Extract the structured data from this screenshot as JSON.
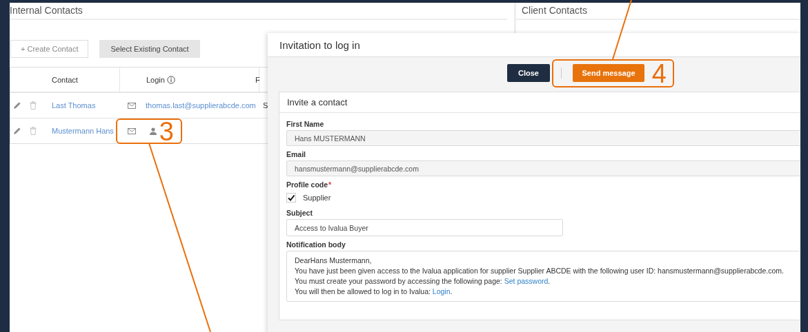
{
  "internal_contacts": {
    "title": "Internal Contacts",
    "buttons": [
      {
        "label": "+ Create Contact",
        "kind": "outline"
      },
      {
        "label": "Select Existing Contact",
        "kind": "filled"
      }
    ],
    "columns": [
      {
        "label": "Contact"
      },
      {
        "label": "Login",
        "info": true
      },
      {
        "label": "F"
      }
    ],
    "rows": [
      {
        "contact": "Last Thomas",
        "login": "thomas.last@supplierabcde.com",
        "column_3": "S",
        "kind": "login"
      },
      {
        "contact": "Mustermann Hans",
        "kind": "no_login"
      }
    ]
  },
  "client_contacts": {
    "title": "Client Contacts"
  },
  "modal": {
    "title": "Invitation to log in",
    "buttons": [
      {
        "label": "Close",
        "kind": "secondary"
      },
      {
        "label": "Send message",
        "kind": "primary"
      }
    ],
    "section": {
      "title": "Invite a contact",
      "fields": [
        {
          "kind": "text",
          "label": "First Name",
          "value": "Hans MUSTERMANN",
          "disabled": true
        },
        {
          "kind": "text",
          "label": "Email",
          "value": "hansmustermann@supplierabcde.com",
          "disabled": true
        },
        {
          "kind": "checkbox",
          "label": "Profile code",
          "required_mark": "*",
          "option": "Supplier",
          "checked": true
        },
        {
          "kind": "short_text",
          "label": "Subject",
          "value": "Access to Ivalua Buyer",
          "disabled": false
        },
        {
          "kind": "body",
          "label": "Notification body",
          "lines": [
            [
              {
                "text": "DearHans Mustermann,"
              }
            ],
            [
              {
                "text": "You have just been given access to the Ivalua application for supplier Supplier ABCDE with the following user ID: hansmustermann@supplierabcde.com."
              }
            ],
            [
              {
                "text": "You must create your password by accessing the following page: "
              },
              {
                "link": "Set password"
              },
              {
                "text": "."
              }
            ],
            [
              {
                "text": "You will then be allowed to log in to Ivalua: "
              },
              {
                "link": "Login"
              },
              {
                "text": "."
              }
            ]
          ]
        }
      ]
    }
  },
  "annotations": [
    {
      "number": "3"
    },
    {
      "number": "4"
    }
  ]
}
